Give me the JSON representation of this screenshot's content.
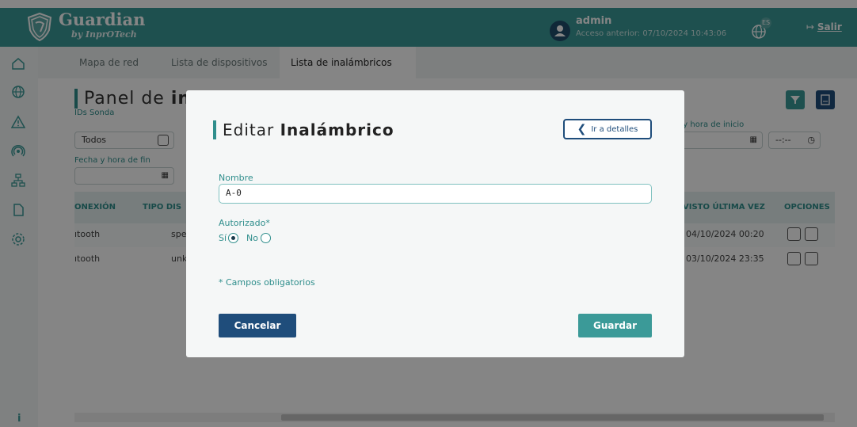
{
  "header": {
    "brand": "Guardian",
    "brand_sub": "by InprOTech",
    "user_name": "admin",
    "last_access": "Acceso anterior: 07/10/2024 10:43:06",
    "language_badge": "ES",
    "logout_label": "Salir"
  },
  "sidebar": {
    "items": [
      {
        "icon": "home-icon"
      },
      {
        "icon": "globe-icon"
      },
      {
        "icon": "warning-icon"
      },
      {
        "icon": "signal-icon"
      },
      {
        "icon": "network-icon"
      },
      {
        "icon": "document-icon"
      },
      {
        "icon": "settings-icon"
      }
    ],
    "info_label": "i"
  },
  "tabs": [
    {
      "label": "Mapa de red"
    },
    {
      "label": "Lista de dispositivos"
    },
    {
      "label": "Lista de inalámbricos"
    }
  ],
  "page": {
    "title_prefix": "Panel de ",
    "title_bold": "ina"
  },
  "filters": {
    "ids_sonda_label": "IDs Sonda",
    "ids_sonda_value": "Todos",
    "fecha_inicio_label": "a y hora de inicio",
    "hora_inicio_value": "--:--",
    "fecha_fin_label": "Fecha y hora de fin"
  },
  "table": {
    "headers": [
      "ONEXIÓN",
      "TIPO DIS",
      "VISTO ÚLTIMA VEZ",
      "OPCIONES"
    ],
    "rows": [
      {
        "conexion": "ıtooth",
        "tipo": "spe",
        "visto": "04/10/2024 00:20"
      },
      {
        "conexion": "ıtooth",
        "tipo": "unk",
        "visto": "03/10/2024 23:35"
      }
    ]
  },
  "modal": {
    "title_prefix": "Editar ",
    "title_bold": "Inalámbrico",
    "back_label": "Ir a detalles",
    "name_label": "Nombre",
    "name_value": "A-0",
    "authorized_label": "Autorizado*",
    "yes_label": "Sí",
    "no_label": "No",
    "authorized_value": "Sí",
    "required_note": "* Campos obligatorios",
    "cancel_label": "Cancelar",
    "save_label": "Guardar"
  },
  "colors": {
    "primary": "#3b9a98",
    "dark_blue": "#1f4d7b",
    "teal_text": "#2f8e8c"
  }
}
